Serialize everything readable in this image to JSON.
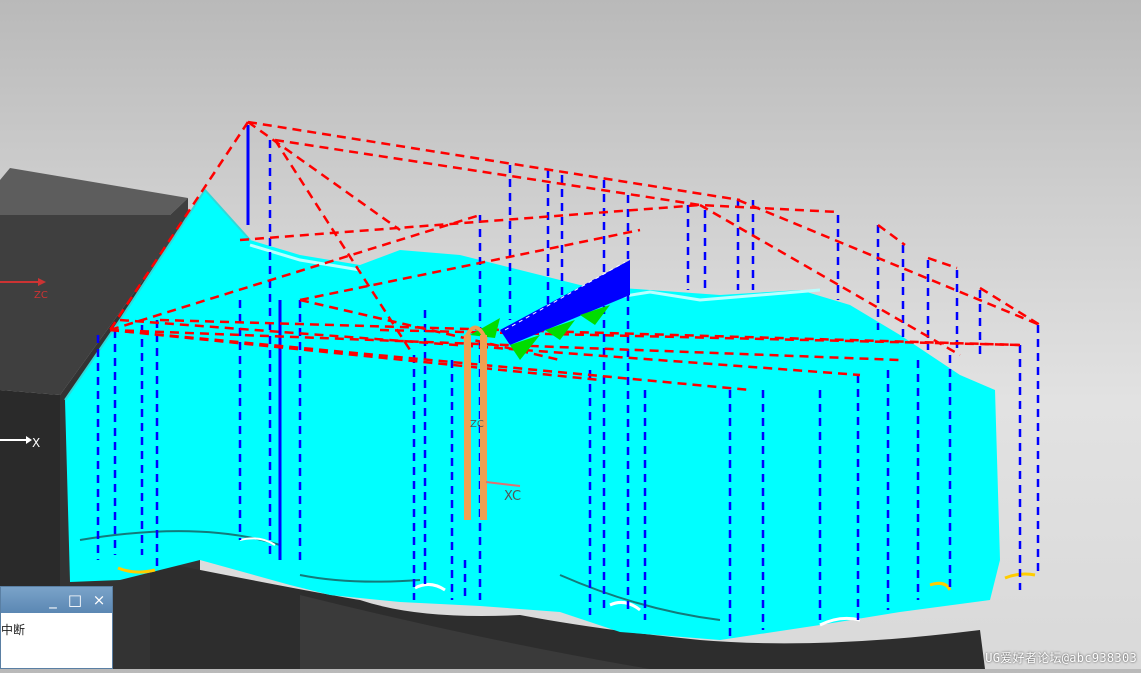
{
  "viewport": {
    "labels": {
      "wcs_x": "X",
      "wcs_zc": "ZC",
      "cursor_x_axis": "XC",
      "cursor_z_axis": "ZC"
    },
    "colors": {
      "background_top": "#b9b9b9",
      "background_bottom": "#e2e2e2",
      "toolpath_cut": "#00ffff",
      "toolpath_rapid": "#ff0000",
      "toolpath_engage": "#0000ff",
      "stock_block": "#3c3c3c",
      "tool_axis": "#f0a050",
      "step_marker": "#00dd00"
    }
  },
  "dialog": {
    "minimize_icon": "_",
    "maximize_icon": "□",
    "close_icon": "×",
    "message": "中断"
  },
  "watermark": "UG爱好者论坛@abc938303"
}
